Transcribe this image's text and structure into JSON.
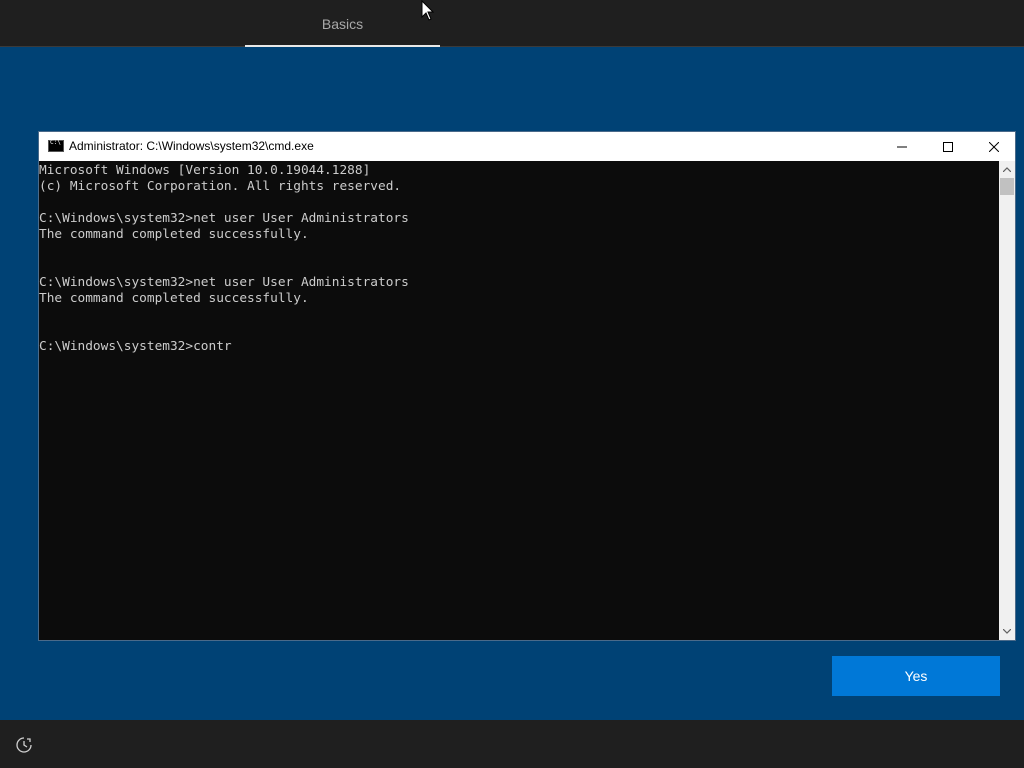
{
  "header": {
    "tab_label": "Basics"
  },
  "cmd": {
    "title": "Administrator: C:\\Windows\\system32\\cmd.exe",
    "lines": [
      "Microsoft Windows [Version 10.0.19044.1288]",
      "(c) Microsoft Corporation. All rights reserved.",
      "",
      "C:\\Windows\\system32>net user User Administrators",
      "The command completed successfully.",
      "",
      "",
      "C:\\Windows\\system32>net user User Administrators",
      "The command completed successfully.",
      "",
      "",
      "C:\\Windows\\system32>contr"
    ]
  },
  "footer": {
    "yes_label": "Yes"
  },
  "icons": {
    "ease_of_access": "ease-of-access-icon",
    "cursor": "mouse-cursor-icon"
  },
  "colors": {
    "background": "#004275",
    "accent": "#0078d7",
    "console_bg": "#0c0c0c",
    "console_text": "#cccccc"
  }
}
